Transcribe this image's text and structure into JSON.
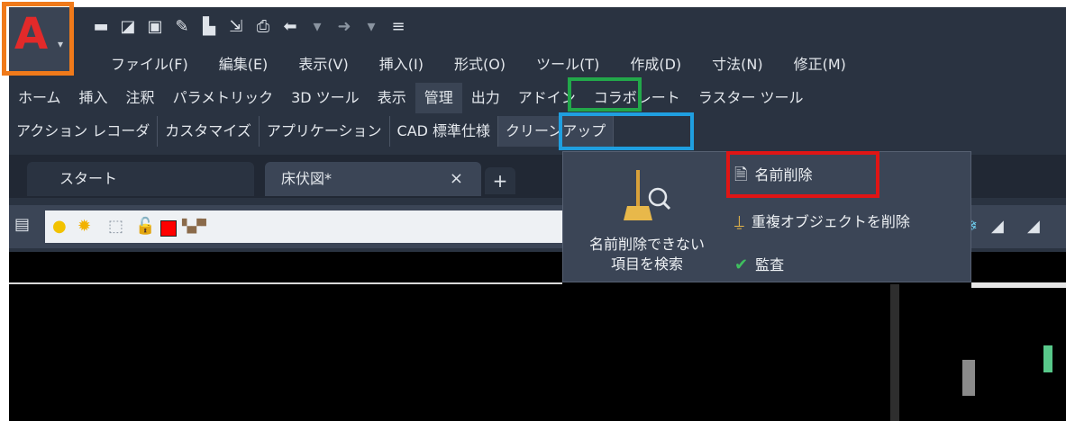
{
  "app": {
    "logo": "A"
  },
  "quick_access": {
    "icons": [
      "new-icon",
      "open-icon",
      "save-icon",
      "save-as-icon",
      "export-icon",
      "import-icon",
      "print-icon",
      "undo-icon",
      "redo-icon",
      "customize-icon"
    ]
  },
  "menubar": {
    "items": [
      "ファイル(F)",
      "編集(E)",
      "表示(V)",
      "挿入(I)",
      "形式(O)",
      "ツール(T)",
      "作成(D)",
      "寸法(N)",
      "修正(M)"
    ]
  },
  "ribbon_tabs": {
    "items": [
      "ホーム",
      "挿入",
      "注釈",
      "パラメトリック",
      "3D ツール",
      "表示",
      "管理",
      "出力",
      "アドイン",
      "コラボレート",
      "ラスター ツール"
    ],
    "active": "管理"
  },
  "panels": {
    "items": [
      "アクション レコーダ",
      "カスタマイズ",
      "アプリケーション",
      "CAD 標準仕様",
      "クリーンアップ"
    ]
  },
  "doc_tabs": {
    "start_label": "スタート",
    "active_label": "床伏図*",
    "close_symbol": "×",
    "add_symbol": "+"
  },
  "dropdown": {
    "big_button_label_line1": "名前削除できない",
    "big_button_label_line2": "項目を検索",
    "items": [
      "名前削除",
      "重複オブジェクトを削除",
      "監査"
    ]
  },
  "colors": {
    "highlight_app": "#f07a1a",
    "highlight_tab": "#22a84a",
    "highlight_panel": "#1f9fe0",
    "highlight_item": "#e01515"
  }
}
